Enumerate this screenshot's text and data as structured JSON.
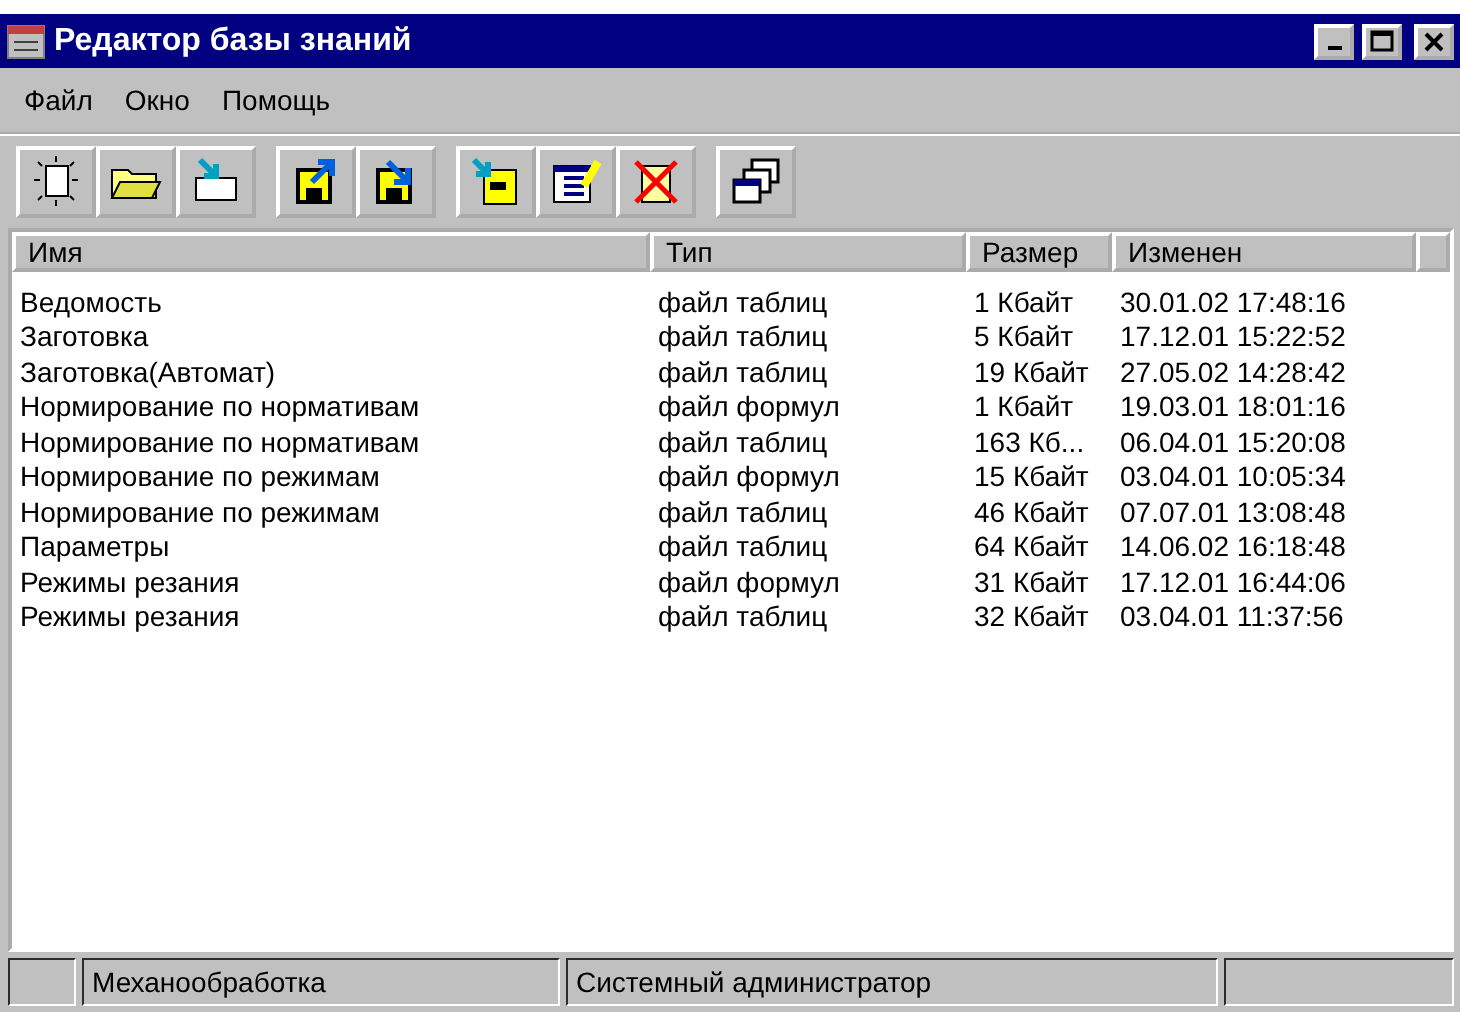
{
  "window": {
    "title": "Редактор базы знаний"
  },
  "menu": [
    "Файл",
    "Окно",
    "Помощь"
  ],
  "toolbar": [
    {
      "kind": "new"
    },
    {
      "kind": "open"
    },
    {
      "kind": "import"
    },
    {
      "kind": "sep"
    },
    {
      "kind": "upload"
    },
    {
      "kind": "download"
    },
    {
      "kind": "sep"
    },
    {
      "kind": "cabinet"
    },
    {
      "kind": "edit"
    },
    {
      "kind": "delete"
    },
    {
      "kind": "sep"
    },
    {
      "kind": "windows"
    }
  ],
  "table": {
    "columns": [
      "Имя",
      "Тип",
      "Размер",
      "Изменен"
    ],
    "rows": [
      [
        "Ведомость",
        "файл таблиц",
        "1 Кбайт",
        "30.01.02 17:48:16"
      ],
      [
        "Заготовка",
        "файл таблиц",
        "5 Кбайт",
        "17.12.01 15:22:52"
      ],
      [
        "Заготовка(Автомат)",
        "файл таблиц",
        "19 Кбайт",
        "27.05.02 14:28:42"
      ],
      [
        "Нормирование по нормативам",
        "файл формул",
        "1 Кбайт",
        "19.03.01 18:01:16"
      ],
      [
        "Нормирование по нормативам",
        "файл таблиц",
        "163 Кб...",
        "06.04.01 15:20:08"
      ],
      [
        "Нормирование по режимам",
        "файл формул",
        "15 Кбайт",
        "03.04.01 10:05:34"
      ],
      [
        "Нормирование по режимам",
        "файл таблиц",
        "46 Кбайт",
        "07.07.01 13:08:48"
      ],
      [
        "Параметры",
        "файл таблиц",
        "64 Кбайт",
        "14.06.02 16:18:48"
      ],
      [
        "Режимы резания",
        "файл формул",
        "31 Кбайт",
        "17.12.01 16:44:06"
      ],
      [
        "Режимы резания",
        "файл таблиц",
        "32 Кбайт",
        "03.04.01 11:37:56"
      ]
    ]
  },
  "status_bar": [
    "Механообработка",
    "Системный администратор"
  ]
}
